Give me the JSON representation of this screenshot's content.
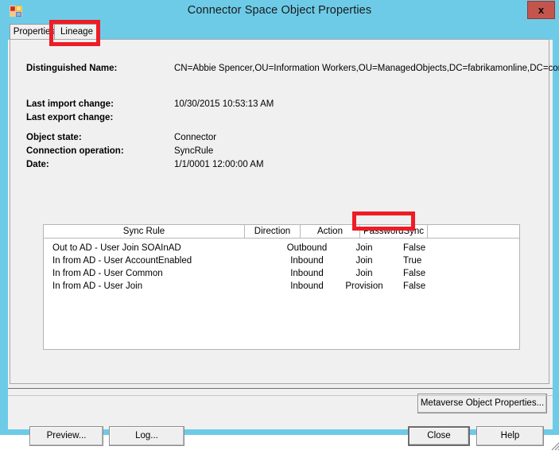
{
  "window": {
    "title": "Connector Space Object Properties",
    "app_icon": "app-window-icon",
    "close_label": "x",
    "frame_color": "#6dcbe8",
    "close_button_color": "#c4554d"
  },
  "tabs": [
    {
      "label": "Properties",
      "selected": false
    },
    {
      "label": "Lineage",
      "selected": true
    }
  ],
  "details": {
    "distinguished_name": {
      "label": "Distinguished Name:",
      "value": "CN=Abbie Spencer,OU=Information Workers,OU=ManagedObjects,DC=fabrikamonline,DC=com"
    },
    "last_import_change": {
      "label": "Last import change:",
      "value": "10/30/2015 10:53:13 AM"
    },
    "last_export_change": {
      "label": "Last export change:",
      "value": ""
    },
    "object_state": {
      "label": "Object state:",
      "value": "Connector"
    },
    "connection_operation": {
      "label": "Connection operation:",
      "value": "SyncRule"
    },
    "date": {
      "label": "Date:",
      "value": "1/1/0001 12:00:00 AM"
    }
  },
  "sync_rules_table": {
    "columns": [
      "Sync Rule",
      "Direction",
      "Action",
      "PasswordSync"
    ],
    "rows": [
      {
        "sync_rule": "Out to AD - User Join SOAInAD",
        "direction": "Outbound",
        "action": "Join",
        "password_sync": "False"
      },
      {
        "sync_rule": "In from AD - User AccountEnabled",
        "direction": "Inbound",
        "action": "Join",
        "password_sync": "True"
      },
      {
        "sync_rule": "In from AD - User Common",
        "direction": "Inbound",
        "action": "Join",
        "password_sync": "False"
      },
      {
        "sync_rule": "In from AD - User Join",
        "direction": "Inbound",
        "action": "Provision",
        "password_sync": "False"
      }
    ]
  },
  "buttons": {
    "metaverse": "Metaverse Object Properties...",
    "preview": "Preview...",
    "log": "Log...",
    "close": "Close",
    "help": "Help"
  },
  "annotations": {
    "color": "#ee1c25",
    "targets": [
      "Lineage tab",
      "True PasswordSync value"
    ]
  }
}
